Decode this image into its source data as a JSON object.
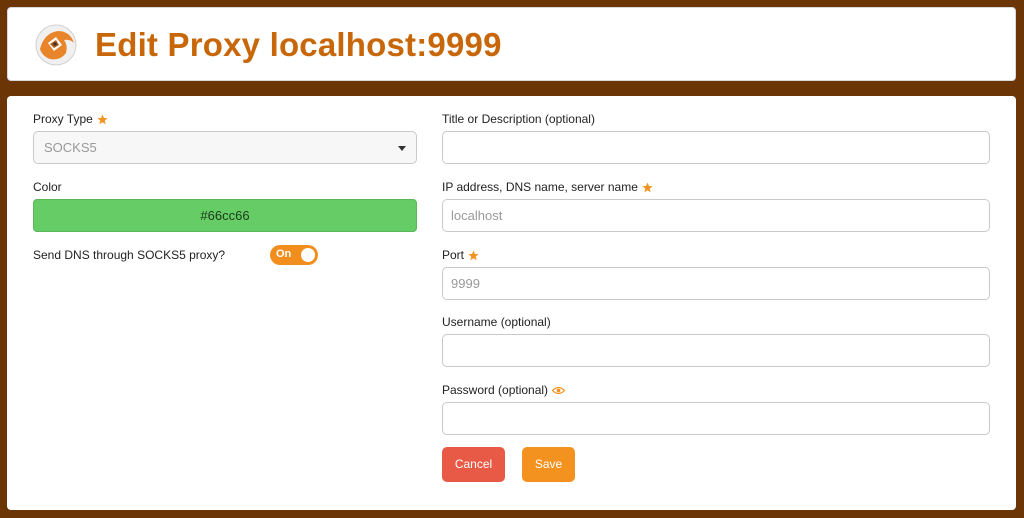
{
  "header": {
    "title": "Edit Proxy localhost:9999",
    "logo_icon": "firefox-fox-logo-icon"
  },
  "form": {
    "proxy_type": {
      "label": "Proxy Type",
      "value": "SOCKS5",
      "required": true
    },
    "color": {
      "label": "Color",
      "value": "#66cc66"
    },
    "dns": {
      "label": "Send DNS through SOCKS5 proxy?",
      "toggle_text": "On",
      "enabled": true
    },
    "title": {
      "label": "Title or Description (optional)",
      "value": ""
    },
    "address": {
      "label": "IP address, DNS name, server name",
      "value": "localhost",
      "required": true
    },
    "port": {
      "label": "Port",
      "value": "9999",
      "required": true
    },
    "username": {
      "label": "Username (optional)",
      "value": ""
    },
    "password": {
      "label": "Password (optional)",
      "value": "",
      "reveal_icon": "eye-icon"
    }
  },
  "actions": {
    "cancel_label": "Cancel",
    "save_label": "Save"
  },
  "colors": {
    "background": "#6b3505",
    "title": "#c8670a",
    "accent": "#f4921f",
    "cancel": "#e85a45",
    "star": "#f4921f"
  }
}
